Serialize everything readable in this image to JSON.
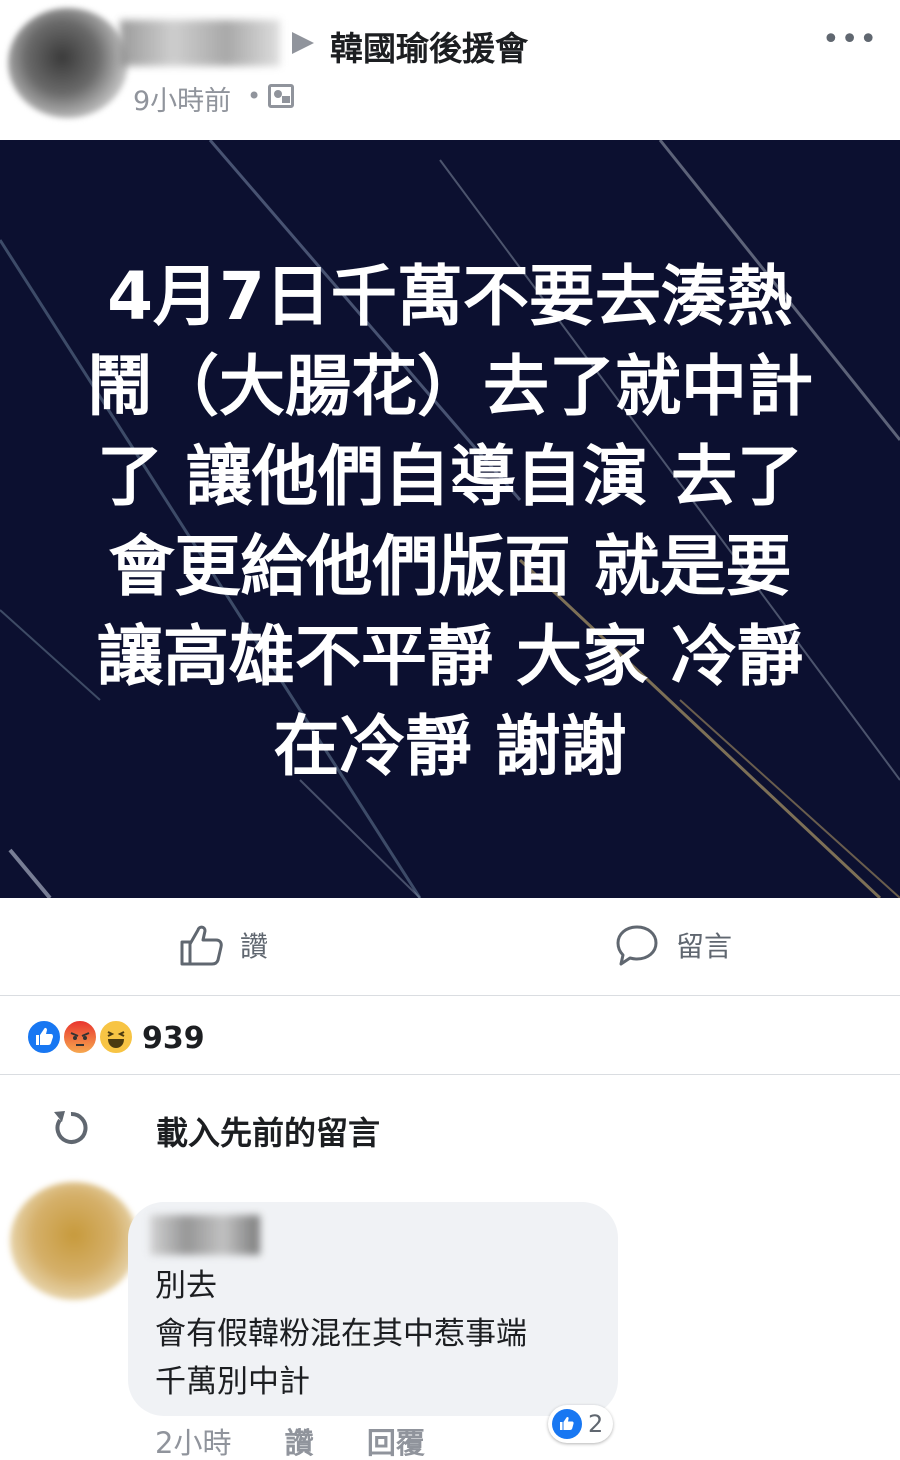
{
  "header": {
    "group_name": "韓國瑜後援會",
    "timestamp": "9小時前",
    "separator": "•"
  },
  "post": {
    "image_text_lines": [
      "4月7日千萬不要去湊熱",
      "鬧（大腸花）去了就中計",
      "了 讓他們自導自演 去了",
      "會更給他們版面  就是要",
      "讓高雄不平靜 大家 冷靜",
      "在冷靜 謝謝"
    ],
    "background_color": "#0c1030"
  },
  "actions": {
    "like_label": "讚",
    "comment_label": "留言"
  },
  "reactions": {
    "types": [
      "like",
      "angry",
      "haha"
    ],
    "count": "939"
  },
  "comments_section": {
    "load_previous_label": "載入先前的留言"
  },
  "comment": {
    "lines": [
      "別去",
      "會有假韓粉混在其中惹事端",
      "千萬別中計"
    ],
    "time": "2小時",
    "like_action": "讚",
    "reply_action": "回覆",
    "like_count": "2"
  }
}
